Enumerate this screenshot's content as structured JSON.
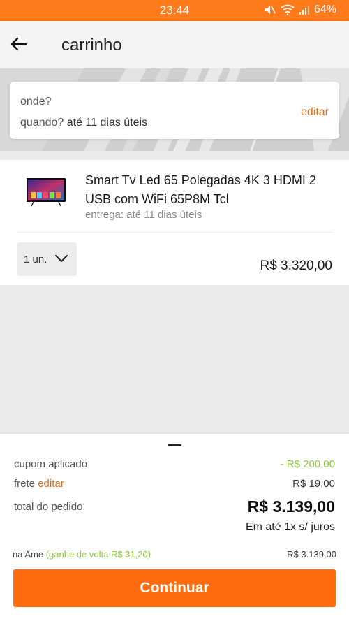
{
  "status_bar": {
    "time": "23:44",
    "battery": "64%"
  },
  "app_bar": {
    "title": "carrinho"
  },
  "delivery": {
    "where_label": "onde?",
    "when_label": "quando?",
    "when_value": "até 11 dias úteis",
    "edit_label": "editar"
  },
  "cart_item": {
    "title": "Smart Tv Led 65 Polegadas 4K 3 HDMI 2 USB com WiFi 65P8M Tcl",
    "delivery": "entrega: até 11 dias úteis",
    "quantity": "1 un.",
    "price": "R$ 3.320,00"
  },
  "summary": {
    "coupon_label": "cupom aplicado",
    "coupon_value": "- R$ 200,00",
    "freight_label": "frete",
    "freight_edit": "editar",
    "freight_value": "R$ 19,00",
    "total_label": "total do pedido",
    "total_value": "R$ 3.139,00",
    "installments": "Em até 1x s/ juros",
    "ame_label": "na Ame",
    "ame_cashback": "(ganhe de volta R$ 31,20)",
    "ame_value": "R$ 3.139,00",
    "continue_label": "Continuar"
  },
  "colors": {
    "brand": "#ff6c10",
    "status_bar": "#ff7a1a",
    "accent_link": "#e07020",
    "discount": "#8cc63f"
  },
  "icons": [
    "arrow-left-icon",
    "chevron-down-icon",
    "mute-icon",
    "wifi-icon",
    "signal-icon"
  ]
}
